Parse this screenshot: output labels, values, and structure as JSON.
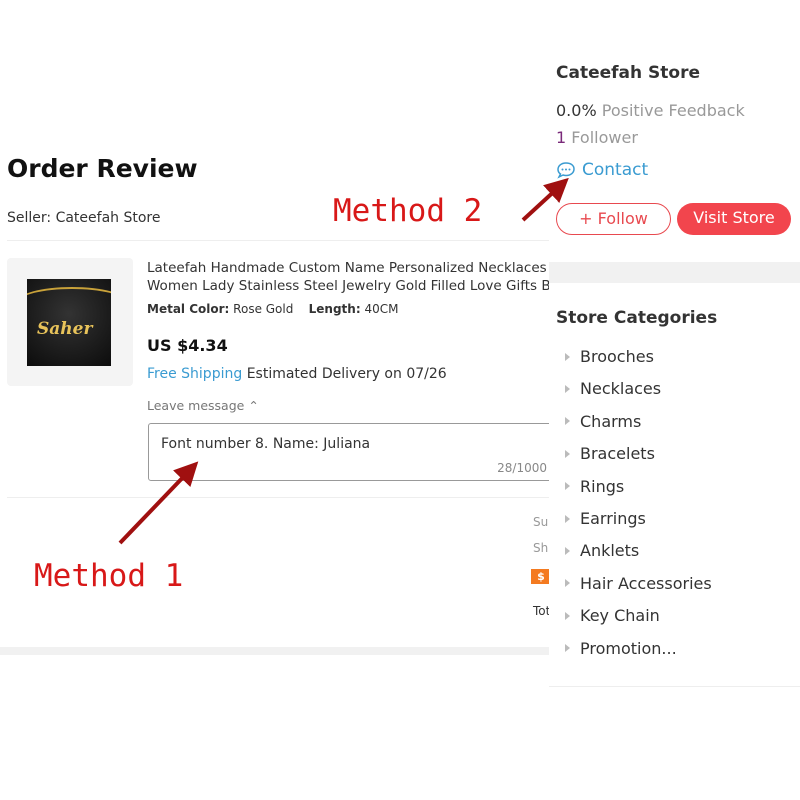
{
  "order": {
    "title": "Order Review",
    "seller": "Seller: Cateefah Store",
    "product": {
      "title_line1": "Lateefah Handmade Custom Name Personalized Necklaces",
      "title_line2": "Women Lady Stainless Steel Jewelry Gold Filled Love Gifts Be",
      "image_text": "Saher",
      "metal_label": "Metal Color:",
      "metal_value": "Rose Gold",
      "length_label": "Length:",
      "length_value": "40CM",
      "price": "US $4.34",
      "free_shipping": "Free Shipping",
      "delivery": "Estimated Delivery on 07/26"
    },
    "leave_message": "Leave message",
    "message_value": "Font number 8. Name: Juliana",
    "message_count": "28/1000",
    "summary": [
      "Sul",
      "Shi",
      "Tot"
    ],
    "badge_icon": "$"
  },
  "store": {
    "name": "Cateefah Store",
    "feedback_value": "0.0%",
    "feedback_label": "Positive Feedback",
    "followers_value": "1",
    "followers_label": "Follower",
    "contact": "Contact",
    "follow": "+ Follow",
    "visit": "Visit Store",
    "categories_title": "Store Categories",
    "categories": [
      "Brooches",
      "Necklaces",
      "Charms",
      "Bracelets",
      "Rings",
      "Earrings",
      "Anklets",
      "Hair Accessories",
      "Key Chain",
      "Promotion..."
    ]
  },
  "annotations": {
    "method1": "Method 1",
    "method2": "Method 2",
    "arrow_color": "#a01010",
    "text_color": "#d81818"
  }
}
